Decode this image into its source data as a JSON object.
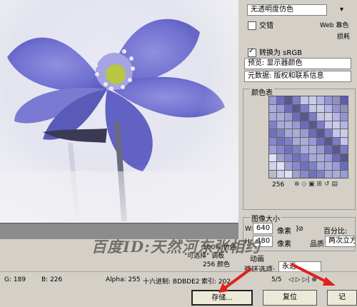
{
  "color_settings": {
    "dither_select": "无透明度仿色",
    "interlaced_label": "交错",
    "web_snap_label": "Web 靠色",
    "lossy_label": "损耗",
    "convert_srgb_label": "转换为 sRGB",
    "preview_select": "预览:  显示器颜色",
    "metadata_select": "元数据:  版权和联系信息"
  },
  "color_table": {
    "title": "颜色表",
    "count": "256",
    "swatch_colors": [
      "#9a9ad8",
      "#7c7cc8",
      "#b4b4e8",
      "#5c5cb4",
      "#d0d0f0",
      "#8888cc",
      "#a8a8dc",
      "#6c6cbc",
      "#c4c4ec",
      "#9494d4",
      "#b8b8a8",
      "#e0e0f4",
      "#7070c0",
      "#acacd8",
      "#58588c",
      "#cccce8",
      "#9090b8",
      "#babacc",
      "#a0a0d0",
      "#8080c4"
    ]
  },
  "image_size": {
    "title": "图像大小",
    "width_label": "W:",
    "width_value": "640",
    "height_label": "H:",
    "height_value": "480",
    "unit": "像素",
    "percent_label": "百分比:",
    "quality_label": "品质:",
    "quality_value": "两次立方"
  },
  "animation": {
    "title": "动画",
    "loop_label": "循环选项:",
    "loop_value": "永远"
  },
  "preview_info": {
    "dither_pct": "100% 仿色",
    "palette": "\"可选择\" 调板",
    "colors": "256 颜色"
  },
  "status": {
    "g": "G: 189",
    "b": "B: 226",
    "alpha": "Alpha: 255",
    "hex": "十六进制: BDBDE2",
    "index": "索引: 202",
    "frame": "5/5"
  },
  "buttons": {
    "save": "存储...",
    "reset": "复位",
    "done": "记"
  },
  "watermark": "百度ID:天然河东张相约"
}
